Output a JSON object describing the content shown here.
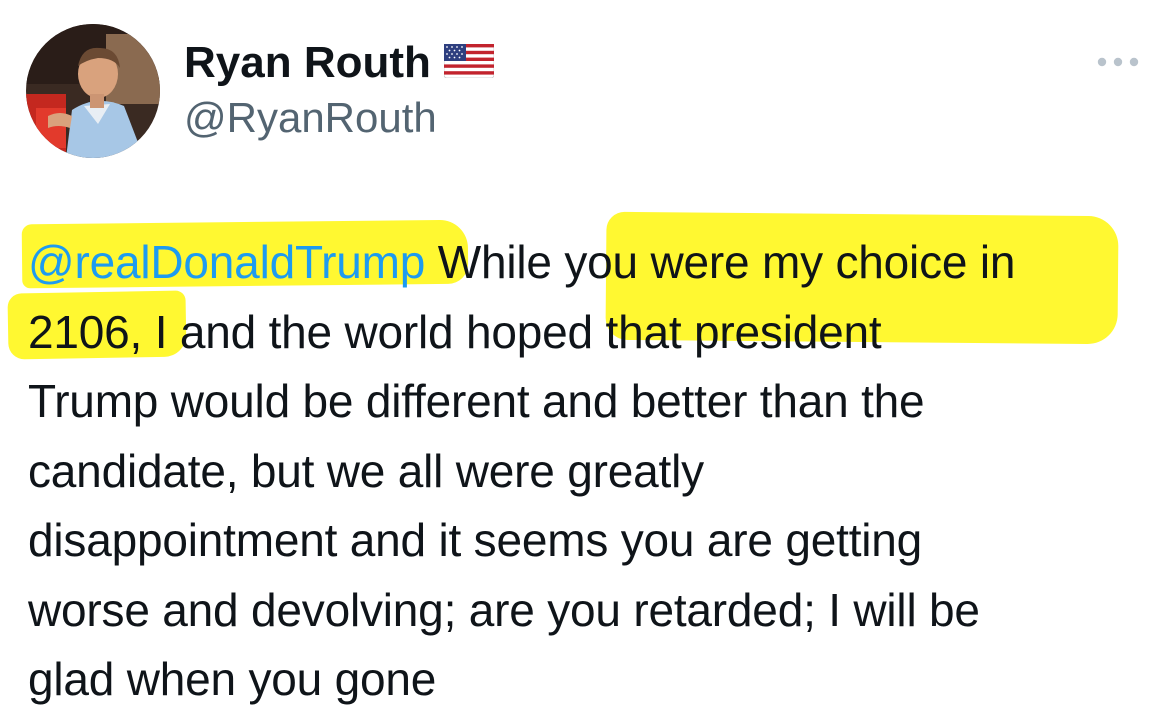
{
  "tweet": {
    "author": {
      "display_name": "Ryan Routh",
      "handle": "@RyanRouth",
      "verified_flag": "us-flag-emoji"
    },
    "more_icon": "more-horizontal-icon",
    "body": {
      "mention": "@realDonaldTrump",
      "line1_rest": " While you were my choice in",
      "line2": "2106, I and the world hoped that president",
      "line3": "Trump would be different and better than the",
      "line4": "candidate, but we all were greatly",
      "line5": "disappointment and it seems you are getting",
      "line6": "worse and devolving; are you retarded; I will be",
      "line7": "glad when you gone"
    }
  },
  "colors": {
    "highlight": "#fff714",
    "mention": "#1d9bf0",
    "text": "#0f1419",
    "secondary": "#536471"
  }
}
